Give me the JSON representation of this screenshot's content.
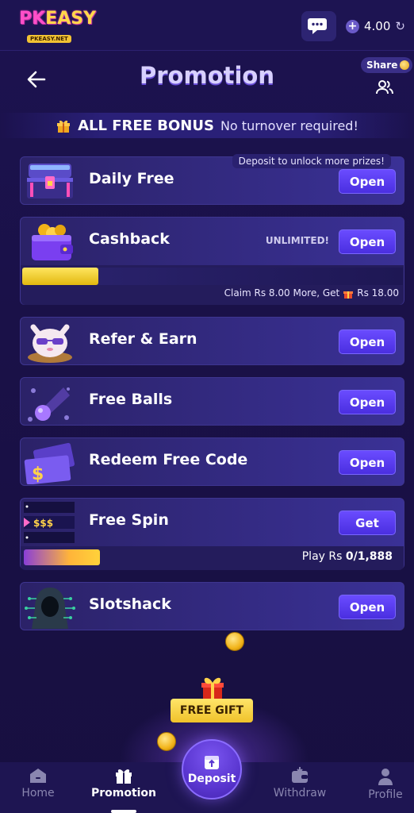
{
  "topbar": {
    "logo_main_a": "PK",
    "logo_main_b": "EASY",
    "logo_sub": "PKEASY.NET",
    "balance": "4.00"
  },
  "header": {
    "title": "Promotion",
    "share_label": "Share"
  },
  "bonus_banner": {
    "strong": "ALL FREE BONUS",
    "light": "No turnover required!"
  },
  "cards": {
    "daily_free": {
      "title": "Daily Free",
      "button": "Open",
      "tip": "Deposit to unlock more prizes!"
    },
    "cashback": {
      "title": "Cashback",
      "button": "Open",
      "badge": "UNLIMITED!",
      "progress_fraction": 0.2,
      "claim_prefix": "Claim Rs 8.00 More, Get",
      "claim_suffix": "Rs 18.00"
    },
    "refer": {
      "title": "Refer & Earn",
      "button": "Open"
    },
    "free_balls": {
      "title": "Free Balls",
      "button": "Open"
    },
    "redeem": {
      "title": "Redeem Free Code",
      "button": "Open"
    },
    "free_spin": {
      "title": "Free Spin",
      "button": "Get",
      "icon_text": "$$$",
      "play_prefix": "Play Rs",
      "play_value": "0/1,888"
    },
    "slotshack": {
      "title": "Slotshack",
      "button": "Open"
    }
  },
  "free_gift": "FREE GIFT",
  "nav": {
    "home": "Home",
    "promotion": "Promotion",
    "deposit": "Deposit",
    "withdraw": "Withdraw",
    "profile": "Profile",
    "active": "promotion"
  }
}
